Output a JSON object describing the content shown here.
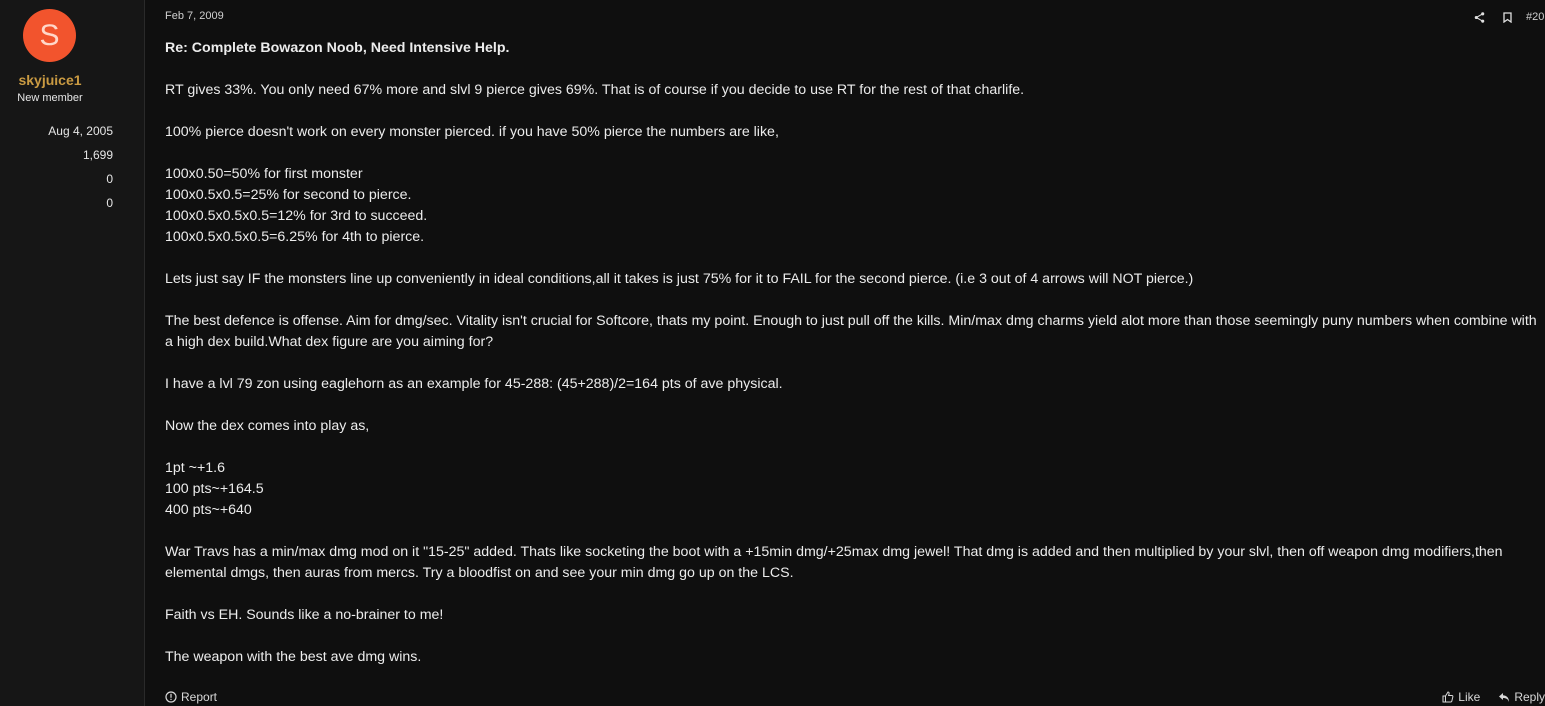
{
  "user": {
    "avatar_letter": "S",
    "avatar_color": "#f2542d",
    "name": "skyjuice1",
    "title": "New member",
    "joined": "Aug 4, 2005",
    "messages": "1,699",
    "reaction_score": "0",
    "points": "0"
  },
  "post": {
    "date": "Feb 7, 2009",
    "number": "#20",
    "title": "Re: Complete Bowazon Noob, Need Intensive Help.",
    "paragraphs": [
      [
        "RT gives 33%. You only need 67% more and slvl 9 pierce gives 69%. That is of course if you decide to use RT for the rest of that charlife."
      ],
      [
        "100% pierce doesn't work on every monster pierced. if you have 50% pierce the numbers are like,"
      ],
      [
        "100x0.50=50% for first monster",
        "100x0.5x0.5=25% for second to pierce.",
        "100x0.5x0.5x0.5=12% for 3rd to succeed.",
        "100x0.5x0.5x0.5=6.25% for 4th to pierce."
      ],
      [
        "Lets just say IF the monsters line up conveniently in ideal conditions,all it takes is just 75% for it to FAIL for the second pierce. (i.e 3 out of 4 arrows will NOT pierce.)"
      ],
      [
        "The best defence is offense. Aim for dmg/sec. Vitality isn't crucial for Softcore, thats my point. Enough to just pull off the kills. Min/max dmg charms yield alot more than those seemingly puny numbers when combine with a high dex build.What dex figure are you aiming for?"
      ],
      [
        "I have a lvl 79 zon using eaglehorn as an example for 45-288: (45+288)/2=164 pts of ave physical."
      ],
      [
        "Now the dex comes into play as,"
      ],
      [
        "1pt ~+1.6",
        "100 pts~+164.5",
        "400 pts~+640"
      ],
      [
        "War Travs has a min/max dmg mod on it \"15-25\" added. Thats like socketing the boot with a +15min dmg/+25max dmg jewel! That dmg is added and then multiplied by your slvl, then off weapon dmg modifiers,then elemental dmgs, then auras from mercs. Try a bloodfist on and see your min dmg go up on the LCS."
      ],
      [
        "Faith vs EH. Sounds like a no-brainer to me!"
      ],
      [
        "The weapon with the best ave dmg wins."
      ]
    ]
  },
  "footer": {
    "report_label": "Report",
    "like_label": "Like",
    "reply_label": "Reply"
  },
  "icons": {
    "share": "share-icon",
    "bookmark": "bookmark-icon",
    "report": "report-icon",
    "like": "thumbs-up-icon",
    "reply": "reply-icon"
  }
}
